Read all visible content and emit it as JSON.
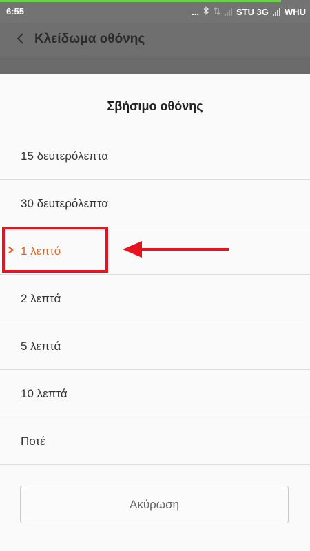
{
  "status_bar": {
    "time": "6:55",
    "dots": "...",
    "carrier1": "STU 3G",
    "carrier2": "WHU",
    "load_color": "#6ed14a"
  },
  "header": {
    "title": "Κλείδωμα οθόνης",
    "back_icon": "chevron-left-icon"
  },
  "dialog": {
    "title": "Σβήσιμο οθόνης",
    "options": [
      {
        "label": "15 δευτερόλεπτα",
        "selected": false
      },
      {
        "label": "30 δευτερόλεπτα",
        "selected": false
      },
      {
        "label": "1 λεπτό",
        "selected": true
      },
      {
        "label": "2 λεπτά",
        "selected": false
      },
      {
        "label": "5 λεπτά",
        "selected": false
      },
      {
        "label": "10 λεπτά",
        "selected": false
      },
      {
        "label": "Ποτέ",
        "selected": false
      }
    ],
    "cancel_label": "Ακύρωση",
    "accent_color": "#e3651d"
  },
  "annotation": {
    "color": "#e8131d"
  }
}
